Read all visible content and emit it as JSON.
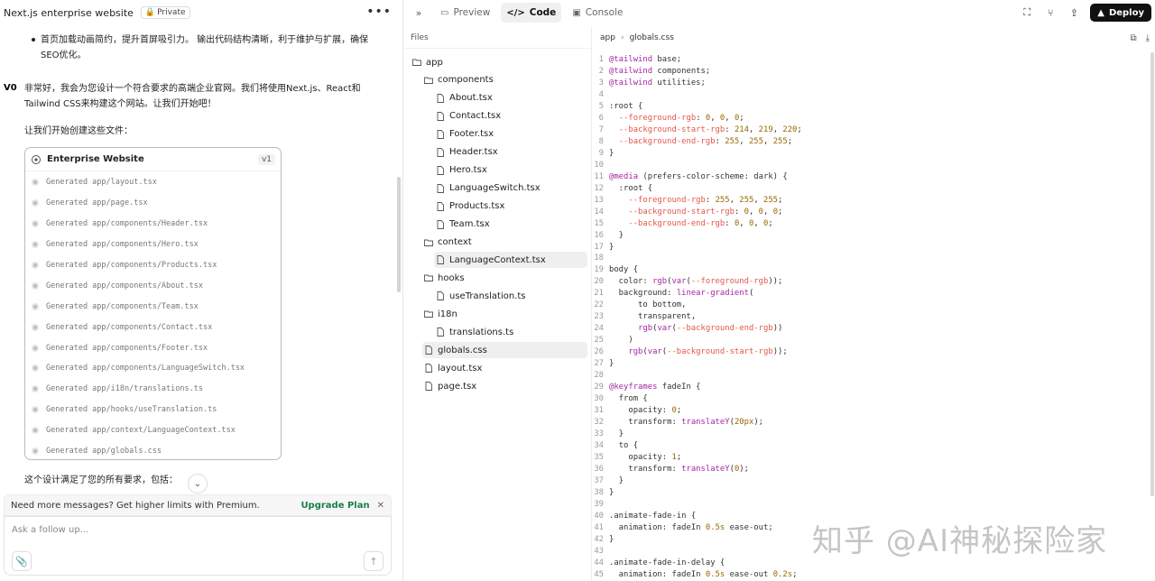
{
  "left": {
    "title": "Next.js enterprise website",
    "private_label": "Private",
    "bullet": "首页加载动画简约，提升首屏吸引力。 输出代码结构清晰，利于维护与扩展，确保SEO优化。",
    "ai_text": "非常好，我会为您设计一个符合要求的高端企业官网。我们将使用Next.js、React和Tailwind CSS来构建这个网站。让我们开始吧！",
    "sub_text": "让我们开始创建这些文件：",
    "card": {
      "title": "Enterprise Website",
      "version": "v1",
      "items": [
        "Generated app/layout.tsx",
        "Generated app/page.tsx",
        "Generated app/components/Header.tsx",
        "Generated app/components/Hero.tsx",
        "Generated app/components/Products.tsx",
        "Generated app/components/About.tsx",
        "Generated app/components/Team.tsx",
        "Generated app/components/Contact.tsx",
        "Generated app/components/Footer.tsx",
        "Generated app/components/LanguageSwitch.tsx",
        "Generated app/i18n/translations.ts",
        "Generated app/hooks/useTranslation.ts",
        "Generated app/context/LanguageContext.tsx",
        "Generated app/globals.css"
      ]
    },
    "after_text": "这个设计满足了您的所有要求，包括：",
    "premium_text": "Need more messages? Get higher limits with Premium.",
    "upgrade_label": "Upgrade Plan",
    "composer_placeholder": "Ask a follow up..."
  },
  "topbar": {
    "tabs": [
      {
        "label": "Preview",
        "icon": "preview-icon"
      },
      {
        "label": "Code",
        "icon": "code-icon"
      },
      {
        "label": "Console",
        "icon": "console-icon"
      }
    ],
    "deploy_label": "Deploy"
  },
  "files": {
    "header": "Files",
    "tree": [
      {
        "name": "app",
        "type": "folder",
        "depth": 0
      },
      {
        "name": "components",
        "type": "folder",
        "depth": 1
      },
      {
        "name": "About.tsx",
        "type": "file",
        "depth": 2
      },
      {
        "name": "Contact.tsx",
        "type": "file",
        "depth": 2
      },
      {
        "name": "Footer.tsx",
        "type": "file",
        "depth": 2
      },
      {
        "name": "Header.tsx",
        "type": "file",
        "depth": 2
      },
      {
        "name": "Hero.tsx",
        "type": "file",
        "depth": 2
      },
      {
        "name": "LanguageSwitch.tsx",
        "type": "file",
        "depth": 2
      },
      {
        "name": "Products.tsx",
        "type": "file",
        "depth": 2
      },
      {
        "name": "Team.tsx",
        "type": "file",
        "depth": 2
      },
      {
        "name": "context",
        "type": "folder",
        "depth": 1
      },
      {
        "name": "LanguageContext.tsx",
        "type": "file",
        "depth": 2,
        "selected": true
      },
      {
        "name": "hooks",
        "type": "folder",
        "depth": 1
      },
      {
        "name": "useTranslation.ts",
        "type": "file",
        "depth": 2
      },
      {
        "name": "i18n",
        "type": "folder",
        "depth": 1
      },
      {
        "name": "translations.ts",
        "type": "file",
        "depth": 2
      },
      {
        "name": "globals.css",
        "type": "file",
        "depth": 1,
        "selected": true
      },
      {
        "name": "layout.tsx",
        "type": "file",
        "depth": 1
      },
      {
        "name": "page.tsx",
        "type": "file",
        "depth": 1
      }
    ]
  },
  "editor": {
    "breadcrumb_root": "app",
    "breadcrumb_file": "globals.css",
    "lines": [
      "@tailwind base;",
      "@tailwind components;",
      "@tailwind utilities;",
      "",
      ":root {",
      "  --foreground-rgb: 0, 0, 0;",
      "  --background-start-rgb: 214, 219, 220;",
      "  --background-end-rgb: 255, 255, 255;",
      "}",
      "",
      "@media (prefers-color-scheme: dark) {",
      "  :root {",
      "    --foreground-rgb: 255, 255, 255;",
      "    --background-start-rgb: 0, 0, 0;",
      "    --background-end-rgb: 0, 0, 0;",
      "  }",
      "}",
      "",
      "body {",
      "  color: rgb(var(--foreground-rgb));",
      "  background: linear-gradient(",
      "      to bottom,",
      "      transparent,",
      "      rgb(var(--background-end-rgb))",
      "    )",
      "    rgb(var(--background-start-rgb));",
      "}",
      "",
      "@keyframes fadeIn {",
      "  from {",
      "    opacity: 0;",
      "    transform: translateY(20px);",
      "  }",
      "  to {",
      "    opacity: 1;",
      "    transform: translateY(0);",
      "  }",
      "}",
      "",
      ".animate-fade-in {",
      "  animation: fadeIn 0.5s ease-out;",
      "}",
      "",
      ".animate-fade-in-delay {",
      "  animation: fadeIn 0.5s ease-out 0.2s;"
    ]
  },
  "watermark": "知乎 @AI神秘探险家"
}
